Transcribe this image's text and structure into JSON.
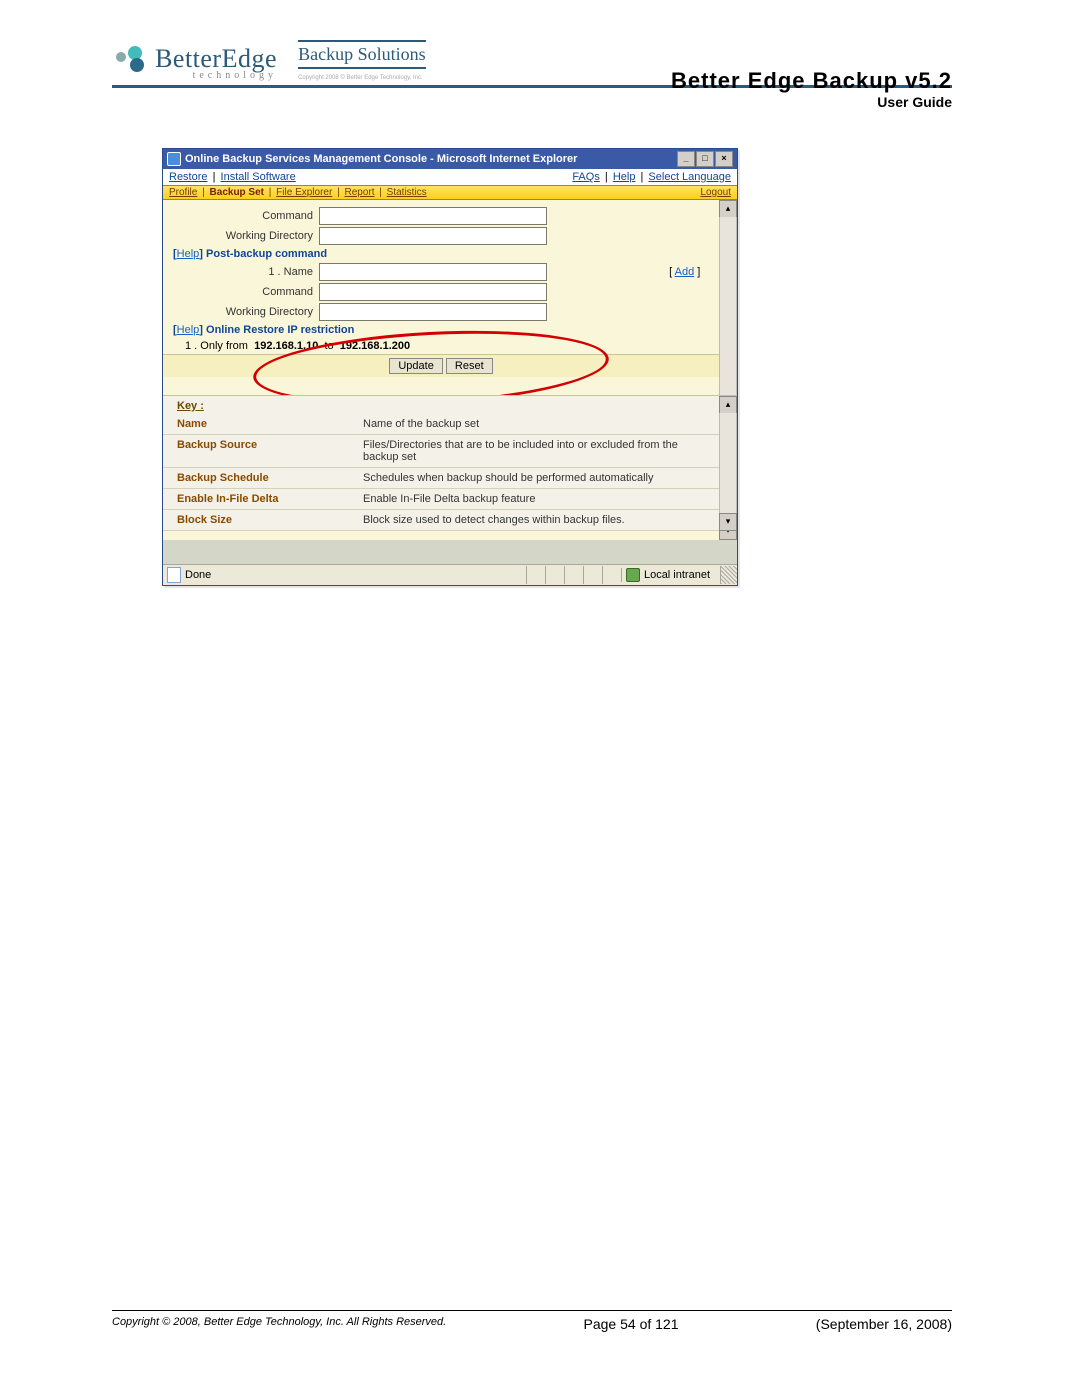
{
  "header": {
    "logo_main": "BetterEdge",
    "logo_sub": "technology",
    "bs_title": "Backup Solutions",
    "bs_sub": "Copyright 2008 © Better Edge Technology, Inc.",
    "title_main": "Better Edge Backup v5.2",
    "title_sub": "User Guide"
  },
  "window": {
    "title": "Online Backup Services Management Console - Microsoft Internet Explorer",
    "linkbar": {
      "restore": "Restore",
      "install": "Install Software",
      "faqs": "FAQs",
      "help": "Help",
      "lang": "Select Language"
    },
    "tabbar": {
      "profile": "Profile",
      "backupset": "Backup Set",
      "fileexplorer": "File Explorer",
      "report": "Report",
      "statistics": "Statistics",
      "logout": "Logout"
    }
  },
  "form": {
    "row1_label": "Command",
    "row2_label": "Working Directory",
    "section_post_hdr_help": "Help",
    "section_post_hdr": "Post-backup command",
    "name_row_prefix": "1 .",
    "name_row_label": "Name",
    "add_link": "Add",
    "cmd2_label": "Command",
    "wd2_label": "Working Directory",
    "section_ip_hdr_help": "Help",
    "section_ip_hdr": "Online Restore IP restriction",
    "ip_row": {
      "prefix": "1 . Only from",
      "from": "192.168.1.10",
      "to_word": "to",
      "to": "192.168.1.200"
    },
    "buttons": {
      "update": "Update",
      "reset": "Reset"
    }
  },
  "key": {
    "header": "Key :",
    "rows": [
      {
        "name": "Name",
        "desc": "Name of the backup set"
      },
      {
        "name": "Backup Source",
        "desc": "Files/Directories that are to be included into or excluded from the backup set"
      },
      {
        "name": "Backup Schedule",
        "desc": "Schedules when backup should be performed automatically"
      },
      {
        "name": "Enable In-File Delta",
        "desc": "Enable In-File Delta backup feature"
      },
      {
        "name": "Block Size",
        "desc": "Block size used to detect changes within backup files."
      }
    ]
  },
  "statusbar": {
    "done": "Done",
    "zone": "Local intranet"
  },
  "footer": {
    "left": "Copyright © 2008, Better Edge Technology, Inc.   All Rights Reserved.",
    "center": "Page 54 of 121",
    "right": "(September 16, 2008)"
  }
}
